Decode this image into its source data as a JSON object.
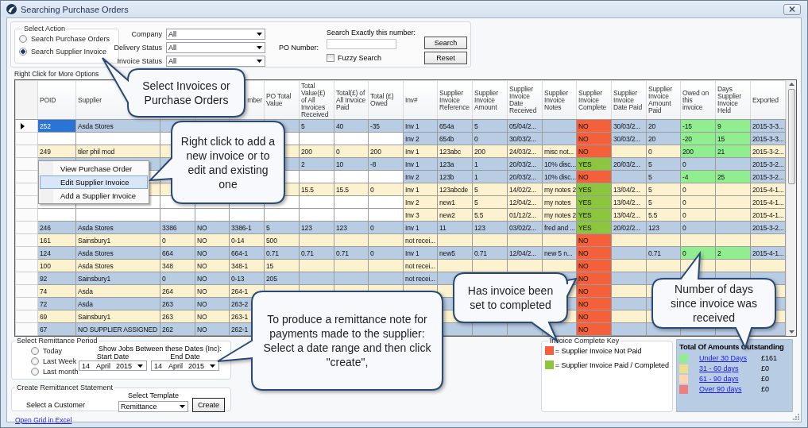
{
  "window": {
    "title": "Searching Purchase Orders"
  },
  "select_action": {
    "title": "Select Action",
    "options": [
      {
        "label": "Search Purchase Orders",
        "selected": false
      },
      {
        "label": "Search Supplier Invoice",
        "selected": true
      }
    ]
  },
  "filters": [
    {
      "label": "Company",
      "value": "All"
    },
    {
      "label": "Delivery Status",
      "value": "All"
    },
    {
      "label": "Invoice Status",
      "value": "All"
    }
  ],
  "po_search": {
    "label": "PO Number:",
    "hint": "Search Exactly this number:",
    "fuzzy": {
      "label": "Fuzzy Search",
      "checked": false
    },
    "buttons": [
      "Search",
      "Reset"
    ]
  },
  "grid": {
    "caption": "Right Click for More Options",
    "columns": [
      "POID",
      "Supplier",
      null,
      null,
      "mber",
      "PO Total Value",
      "Total Value(£) of All Invoices Received",
      "Total(£) of All Invoice Paid",
      "Total (£) Owed",
      "Inv#",
      "Supplier Invoice Reference",
      "Supplier Invoice Amount",
      "Supplier Invoice Date Received",
      "Supplier Invoice Notes",
      "Supplier Invoice Complete",
      "Supplier Invoice Date Paid",
      "Supplier Invoice Amount Paid",
      "Owed on this invoice",
      "Days Supplier Invoice Held",
      "Exported"
    ],
    "rows": [
      {
        "selected": true,
        "continuation": false,
        "color": "#b8cce4",
        "complete": false,
        "flagged": true,
        "cells": [
          "252",
          "Asda Stores",
          null,
          null,
          null,
          null,
          "5",
          "40",
          "-35",
          "Inv 1",
          "654a",
          "5",
          "05/04/2...",
          null,
          "NO",
          "30/03/2...",
          "20",
          "-15",
          "9",
          "2015-3-3..."
        ]
      },
      {
        "selected": false,
        "continuation": true,
        "color": "#b8cce4",
        "complete": false,
        "flagged": true,
        "cells": [
          null,
          null,
          null,
          null,
          null,
          null,
          null,
          null,
          null,
          "Inv 2",
          "654b",
          "0",
          "30/03/2...",
          null,
          "NO",
          "30/03/2...",
          "20",
          "-20",
          "15",
          "2015-3-3..."
        ]
      },
      {
        "selected": false,
        "continuation": false,
        "color": "#fdf2d0",
        "complete": false,
        "flagged": true,
        "cells": [
          "249",
          "tiler phil mod",
          null,
          null,
          null,
          null,
          "200",
          "0",
          "200",
          "Inv 1",
          "123abc",
          "200",
          "24/03/2...",
          "misc not...",
          "NO",
          null,
          "0",
          "200",
          "21",
          "2015-3-2..."
        ]
      },
      {
        "selected": false,
        "continuation": false,
        "color": "#b8cce4",
        "complete": true,
        "flagged": false,
        "cells": [
          null,
          null,
          null,
          null,
          null,
          null,
          "2",
          "10",
          "-8",
          "Inv 1",
          "123a",
          "1",
          "20/03/2...",
          "10% disc...",
          "YES",
          "20/03/2...",
          "5",
          "0",
          null,
          "2015-3-2..."
        ]
      },
      {
        "selected": false,
        "continuation": true,
        "color": "#b8cce4",
        "complete": false,
        "flagged": true,
        "cells": [
          null,
          null,
          null,
          null,
          null,
          null,
          null,
          null,
          null,
          "Inv 2",
          "123b",
          "1",
          "20/03/2...",
          "10% disc...",
          "NO",
          null,
          "5",
          "-4",
          "25",
          "2015-3-2..."
        ]
      },
      {
        "selected": false,
        "continuation": false,
        "color": "#fdf2d0",
        "complete": true,
        "flagged": false,
        "cells": [
          null,
          null,
          null,
          null,
          null,
          null,
          "15.5",
          "15.5",
          "0",
          "Inv 1",
          "123abcde",
          "5",
          "14/02/2...",
          "my notes 2",
          "YES",
          "13/04/2...",
          "5",
          "0",
          null,
          "2015-4-1..."
        ]
      },
      {
        "selected": false,
        "continuation": true,
        "color": "#fdf2d0",
        "complete": true,
        "flagged": false,
        "cells": [
          null,
          null,
          null,
          null,
          null,
          null,
          null,
          null,
          null,
          "Inv 2",
          "new1",
          "5",
          "12/04/2...",
          "my notes",
          "YES",
          "13/04/2...",
          "5",
          "0",
          null,
          "2015-4-1..."
        ]
      },
      {
        "selected": false,
        "continuation": true,
        "color": "#fdf2d0",
        "complete": true,
        "flagged": false,
        "cells": [
          null,
          null,
          null,
          null,
          null,
          null,
          null,
          null,
          null,
          "Inv 3",
          "new2",
          "5.5",
          "01/12/2...",
          "my notes 2",
          "YES",
          "13/04/2...",
          "5.5",
          "0",
          null,
          "2015-4-1..."
        ]
      },
      {
        "selected": false,
        "continuation": false,
        "color": "#b8cce4",
        "complete": true,
        "flagged": false,
        "cells": [
          "246",
          "Asda Stores",
          "3386",
          "NO",
          "3386-1",
          "5",
          "123",
          "123",
          "0",
          "Inv 1",
          "11",
          "123",
          "03/02/2...",
          "fred and ...",
          "YES",
          "20/02/2...",
          "123",
          "0",
          null,
          "2015-3-2..."
        ]
      },
      {
        "selected": false,
        "continuation": false,
        "color": "#fdf2d0",
        "complete": false,
        "flagged": false,
        "cells": [
          "161",
          "Sainsbury1",
          "0",
          "NO",
          "0-14",
          "500",
          null,
          null,
          null,
          "not recei...",
          null,
          null,
          null,
          null,
          "NO",
          null,
          null,
          null,
          null,
          null
        ]
      },
      {
        "selected": false,
        "continuation": false,
        "color": "#b8cce4",
        "complete": false,
        "flagged": true,
        "cells": [
          "124",
          "Asda Stores",
          "664",
          "NO",
          "664-1",
          "0.71",
          "0.71",
          "0.71",
          "0",
          "Inv 1",
          "new5",
          "0.71",
          "12/04/2...",
          "new 5 n...",
          "NO",
          null,
          "0.71",
          "0",
          "2",
          "2015-4-1..."
        ]
      },
      {
        "selected": false,
        "continuation": false,
        "color": "#fdf2d0",
        "complete": false,
        "flagged": false,
        "cells": [
          "100",
          "Asda Stores",
          "348",
          "NO",
          "348-1",
          "15",
          null,
          null,
          null,
          "not recei...",
          null,
          null,
          null,
          null,
          "NO",
          null,
          null,
          null,
          null,
          null
        ]
      },
      {
        "selected": false,
        "continuation": false,
        "color": "#b8cce4",
        "complete": false,
        "cells": [
          "92",
          "Sainsbury1",
          "0",
          "NO",
          "0-13",
          "205",
          null,
          null,
          null,
          "not recei...",
          null,
          null,
          null,
          null,
          "NO",
          null,
          null,
          null,
          null,
          null
        ]
      },
      {
        "selected": false,
        "continuation": false,
        "color": "#fdf2d0",
        "complete": false,
        "cells": [
          "74",
          "Asda",
          "264",
          "NO",
          "264-1",
          null,
          null,
          null,
          null,
          null,
          null,
          null,
          null,
          null,
          "NO",
          null,
          null,
          null,
          null,
          null
        ]
      },
      {
        "selected": false,
        "continuation": false,
        "color": "#b8cce4",
        "complete": false,
        "cells": [
          "72",
          "Asda",
          "263",
          "NO",
          "263-2",
          null,
          null,
          null,
          null,
          null,
          null,
          null,
          null,
          null,
          "NO",
          null,
          null,
          null,
          null,
          null
        ]
      },
      {
        "selected": false,
        "continuation": false,
        "color": "#fdf2d0",
        "complete": false,
        "cells": [
          "69",
          "Sainsbury1",
          "263",
          "NO",
          "263-1",
          null,
          null,
          null,
          null,
          null,
          null,
          null,
          null,
          null,
          "NO",
          null,
          null,
          null,
          null,
          null
        ]
      },
      {
        "selected": false,
        "continuation": false,
        "color": "#b8cce4",
        "complete": false,
        "flagged": false,
        "cells": [
          "67",
          "NO SUPPLIER ASSIGNED",
          "262",
          "NO",
          "262-1",
          null,
          null,
          null,
          null,
          null,
          null,
          null,
          null,
          null,
          "NO",
          null,
          null,
          null,
          null,
          null
        ]
      }
    ]
  },
  "context_menu": {
    "items": [
      {
        "label": "View Purchase Order",
        "selected": false
      },
      {
        "label": "Edit Supplier Invoice",
        "selected": true
      },
      {
        "label": "Add a Supplier Invoice",
        "selected": false
      }
    ]
  },
  "remittance_period": {
    "title": "Select Remittance Period",
    "options": [
      {
        "label": "Today",
        "selected": false
      },
      {
        "label": "Last Week",
        "selected": false
      },
      {
        "label": "Last month",
        "selected": false
      }
    ],
    "range_hint": "Show Jobs Between these Dates (Inc):",
    "start": {
      "label": "Start Date",
      "day": "14",
      "month": "April",
      "year": "2015"
    },
    "end": {
      "label": "End Date",
      "day": "14",
      "month": "April",
      "year": "2015"
    }
  },
  "statement": {
    "title": "Create Remittancet Statement",
    "customer_label": "Select a Customer",
    "template_label": "Select Template",
    "template": "Remittance",
    "button": "Create"
  },
  "excel_link": "Open Grid in Excel",
  "key": {
    "title": "Invoice Complete Key",
    "items": [
      {
        "color": "#f4603c",
        "label": "= Supplier Invoice Not Paid"
      },
      {
        "color": "#8cc63f",
        "label": "= Supplier Invoice Paid / Completed"
      }
    ]
  },
  "totals": {
    "title": "Total Of Amounts Outstanding",
    "items": [
      {
        "color": "#90ee90",
        "label": "Under 30 Days",
        "value": "£161"
      },
      {
        "color": "#eee08a",
        "label": "31 - 60 days",
        "value": "£0"
      },
      {
        "color": "#fdd5b1",
        "label": "61 - 90 days",
        "value": "£0"
      },
      {
        "color": "#ee7f7f",
        "label": "Over 90 days",
        "value": "£0"
      }
    ]
  },
  "callouts": [
    {
      "text": "Select Invoices or Purchase Orders"
    },
    {
      "text": "Right click to add a new invoice or to edit and existing one"
    },
    {
      "text": "To produce a remittance note for payments made to the supplier:\nSelect a date range and then click \"create\","
    },
    {
      "text": "Has invoice been set to completed"
    },
    {
      "text": "Number of days since invoice was received"
    }
  ]
}
